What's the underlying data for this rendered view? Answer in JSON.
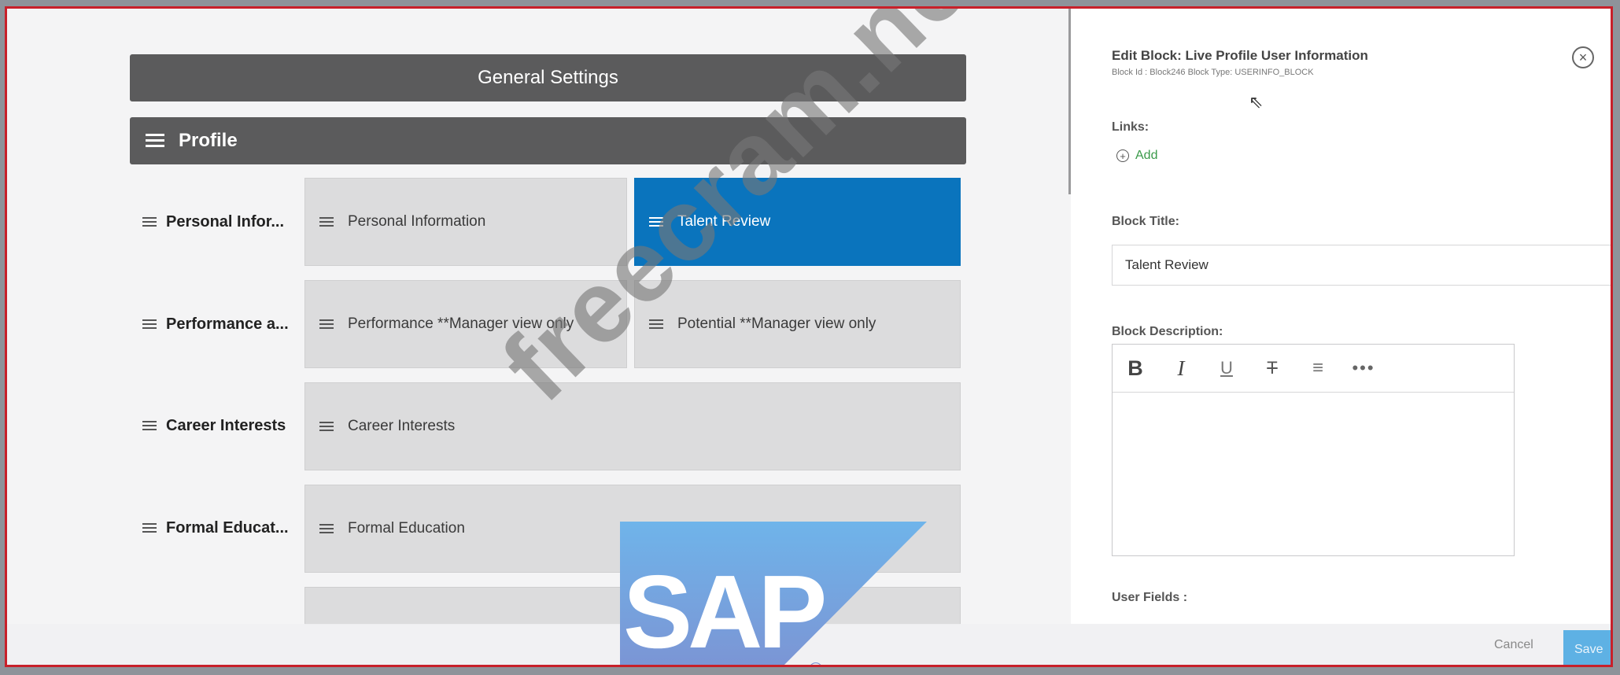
{
  "settings": {
    "general_title": "General Settings",
    "profile_title": "Profile"
  },
  "rows": [
    {
      "label": "Personal Infor...",
      "blocks": [
        "Personal Information",
        "Talent Review"
      ]
    },
    {
      "label": "Performance a...",
      "blocks": [
        "Performance **Manager view only",
        "Potential **Manager view only"
      ]
    },
    {
      "label": "Career Interests",
      "blocks": [
        "Career Interests"
      ]
    },
    {
      "label": "Formal Educat...",
      "blocks": [
        "Formal Education"
      ]
    }
  ],
  "selected_block": "Talent Review",
  "panel": {
    "title": "Edit Block: Live Profile User Information",
    "subtitle": "Block Id : Block246  Block Type: USERINFO_BLOCK",
    "links_label": "Links:",
    "add_label": "Add",
    "block_title_label": "Block Title:",
    "block_title_value": "Talent Review",
    "block_description_label": "Block Description:",
    "user_fields_label": "User Fields :",
    "toolbar": [
      "B",
      "I",
      "U",
      "T",
      "≡",
      "•••"
    ]
  },
  "footer": {
    "cancel_label": "Cancel",
    "save_label": "Save"
  },
  "watermark": "freecram.net",
  "logo": {
    "text": "SAP",
    "registered": "®"
  },
  "colors": {
    "accent": "#0a74bd",
    "bar": "#5b5b5c",
    "block": "#dcdcdd",
    "frame_border": "#c8202a",
    "add_link": "#3a9a4a"
  }
}
